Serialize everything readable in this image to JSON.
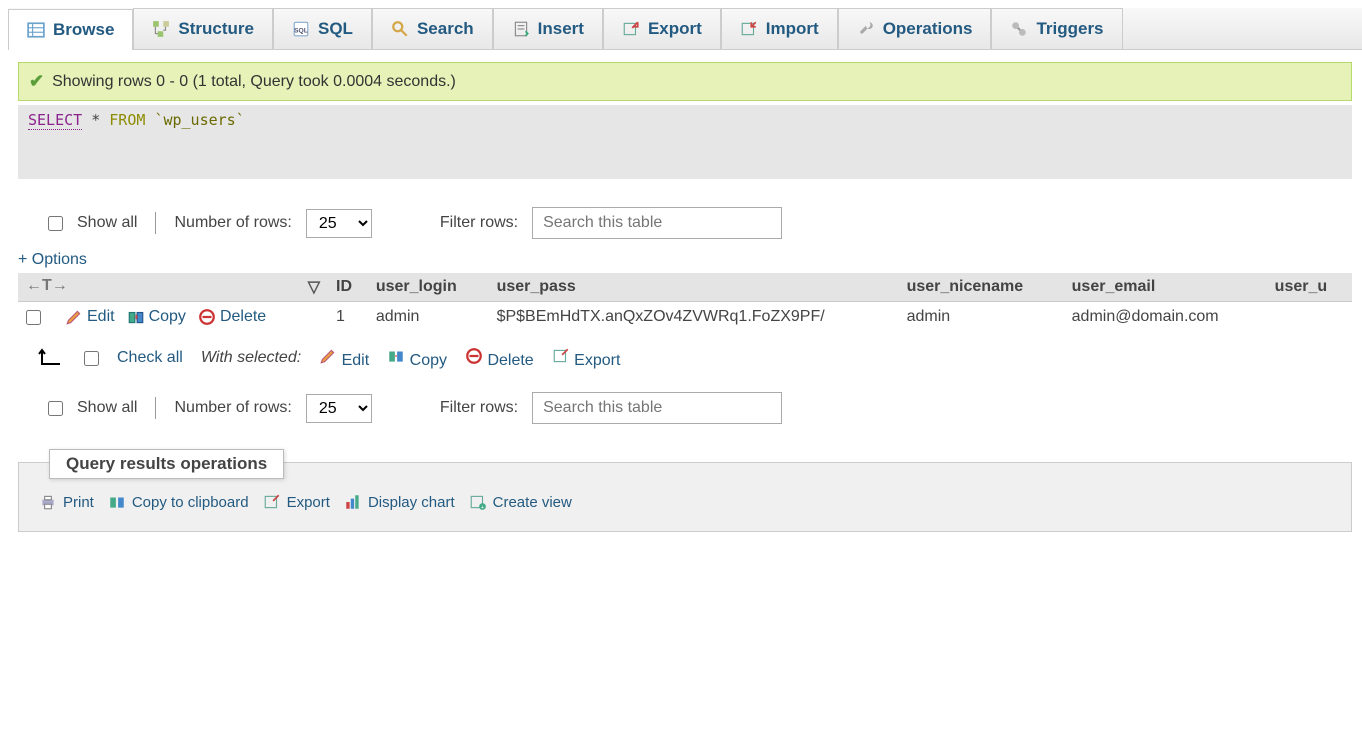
{
  "tabs": [
    {
      "label": "Browse",
      "active": true
    },
    {
      "label": "Structure"
    },
    {
      "label": "SQL"
    },
    {
      "label": "Search"
    },
    {
      "label": "Insert"
    },
    {
      "label": "Export"
    },
    {
      "label": "Import"
    },
    {
      "label": "Operations"
    },
    {
      "label": "Triggers"
    }
  ],
  "success_msg": "Showing rows 0 - 0 (1 total, Query took 0.0004 seconds.)",
  "sql": {
    "select": "SELECT",
    "star": "*",
    "from": "FROM",
    "table": "`wp_users`"
  },
  "controls": {
    "show_all": "Show all",
    "num_rows_label": "Number of rows:",
    "num_rows_value": "25",
    "filter_label": "Filter rows:",
    "filter_placeholder": "Search this table"
  },
  "options_label": "+ Options",
  "columns": [
    "ID",
    "user_login",
    "user_pass",
    "user_nicename",
    "user_email",
    "user_u"
  ],
  "row": {
    "edit": "Edit",
    "copy": "Copy",
    "delete": "Delete",
    "id": "1",
    "user_login": "admin",
    "user_pass": "$P$BEmHdTX.anQxZOv4ZVWRq1.FoZX9PF/",
    "user_nicename": "admin",
    "user_email": "admin@domain.com"
  },
  "bulk": {
    "check_all": "Check all",
    "with_selected": "With selected:",
    "edit": "Edit",
    "copy": "Copy",
    "delete": "Delete",
    "export": "Export"
  },
  "qops": {
    "title": "Query results operations",
    "print": "Print",
    "copy_clipboard": "Copy to clipboard",
    "export": "Export",
    "display_chart": "Display chart",
    "create_view": "Create view"
  }
}
